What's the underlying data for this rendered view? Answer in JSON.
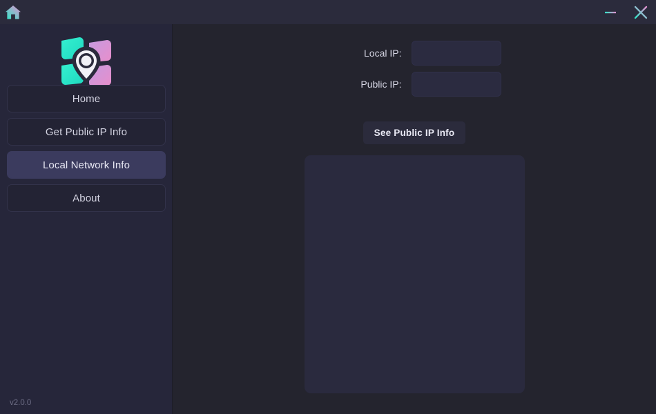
{
  "window": {
    "title": "",
    "home_icon": "home-icon",
    "minimize_label": "–",
    "close_label": "✕",
    "accent_start": "#2ee8c8",
    "accent_end": "#e58fd0"
  },
  "sidebar": {
    "logo_alt": "map-tiles-pin-logo",
    "items": [
      {
        "label": "Home",
        "active": false
      },
      {
        "label": "Get Public IP Info",
        "active": false
      },
      {
        "label": "Local Network Info",
        "active": true
      },
      {
        "label": "About",
        "active": false
      }
    ],
    "version": "v2.0.0"
  },
  "main": {
    "local_ip": {
      "label": "Local IP:",
      "value": "",
      "placeholder": ""
    },
    "public_ip": {
      "label": "Public IP:",
      "value": "",
      "placeholder": ""
    },
    "action_button": "See Public IP Info",
    "output": ""
  },
  "colors": {
    "background": "#24242e",
    "sidebar": "#26263a",
    "titlebar": "#2b2b3c",
    "panel": "#2a2a3e",
    "active_item": "#3b3b5e",
    "text": "#d8d8e4",
    "muted_text": "#6e6e86"
  }
}
